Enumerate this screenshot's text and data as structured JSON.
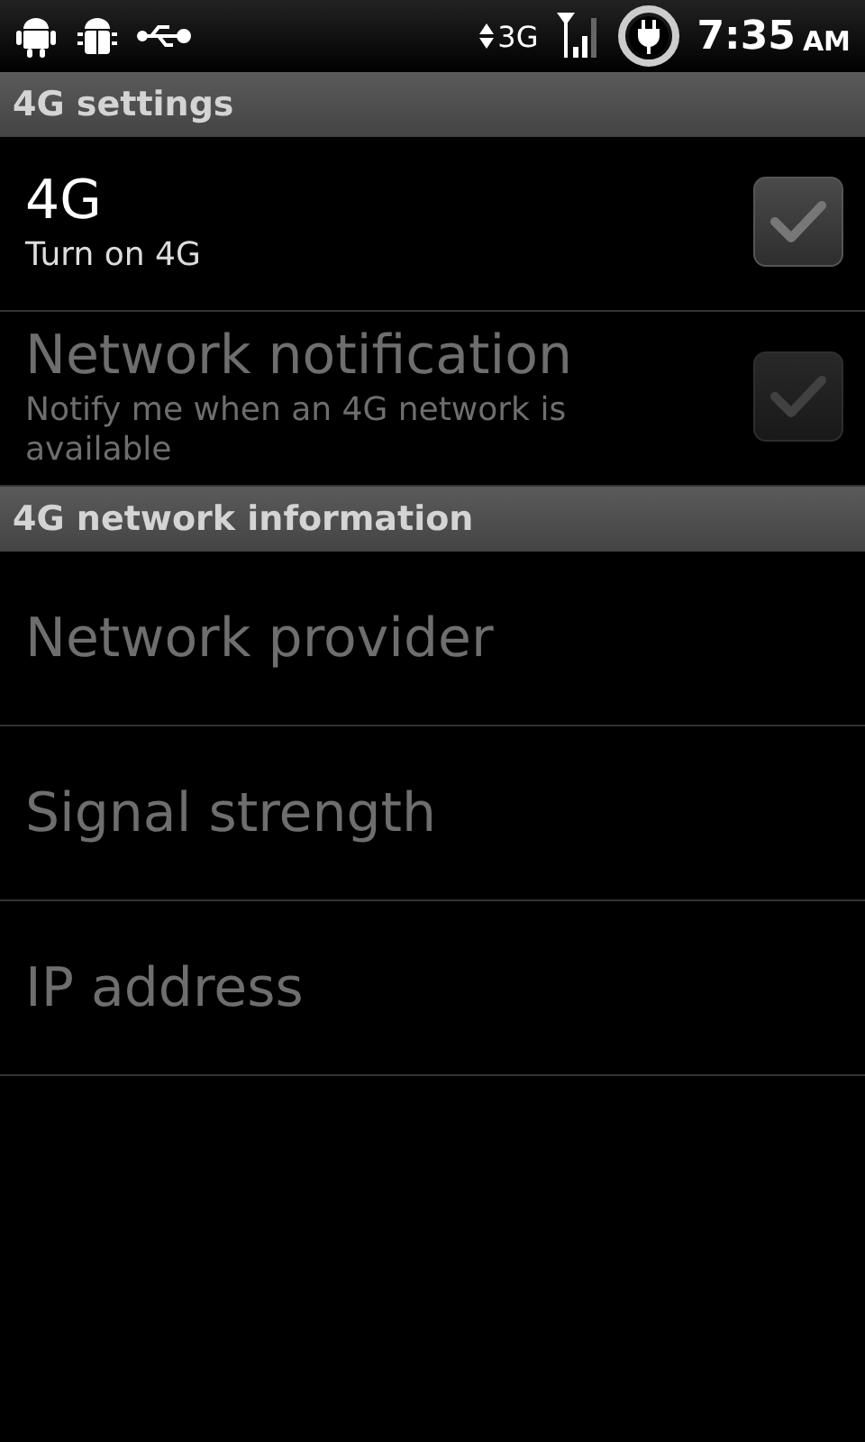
{
  "status_bar": {
    "network": "3G",
    "time": "7:35",
    "am_pm": "AM"
  },
  "sections": [
    {
      "header": "4G settings",
      "items": [
        {
          "kind": "checkbox",
          "title": "4G",
          "summary": "Turn on 4G",
          "checked": false,
          "disabled": false
        },
        {
          "kind": "checkbox",
          "title": "Network notification",
          "summary": "Notify me when an 4G network is available",
          "checked": false,
          "disabled": true
        }
      ]
    },
    {
      "header": "4G network information",
      "items": [
        {
          "kind": "text",
          "title": "Network provider",
          "disabled": true
        },
        {
          "kind": "text",
          "title": "Signal strength",
          "disabled": true
        },
        {
          "kind": "text",
          "title": "IP address",
          "disabled": true
        }
      ]
    }
  ]
}
